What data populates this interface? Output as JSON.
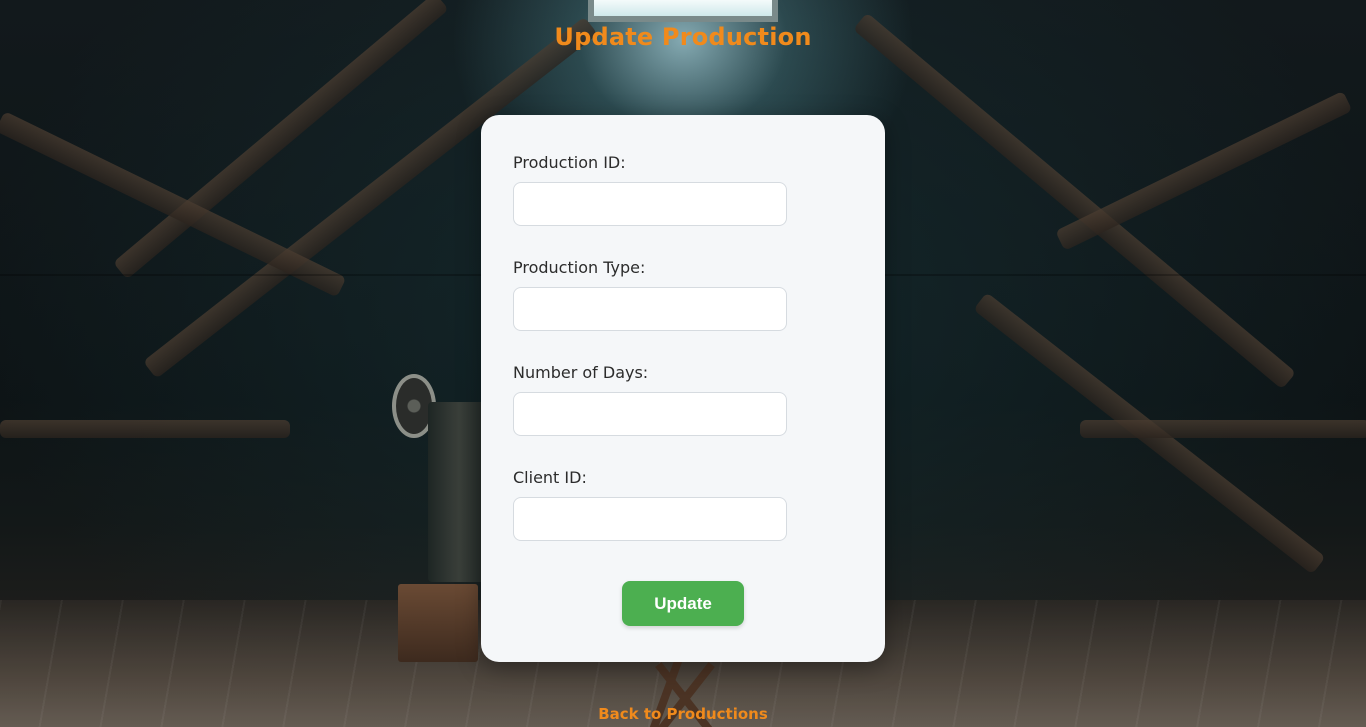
{
  "page": {
    "title": "Update Production",
    "accent_color": "#f08a1c"
  },
  "form": {
    "fields": [
      {
        "label": "Production ID:",
        "value": ""
      },
      {
        "label": "Production Type:",
        "value": ""
      },
      {
        "label": "Number of Days:",
        "value": ""
      },
      {
        "label": "Client ID:",
        "value": ""
      }
    ],
    "submit_label": "Update",
    "submit_color": "#4caf50"
  },
  "footer": {
    "back_link": "Back to Productions"
  }
}
